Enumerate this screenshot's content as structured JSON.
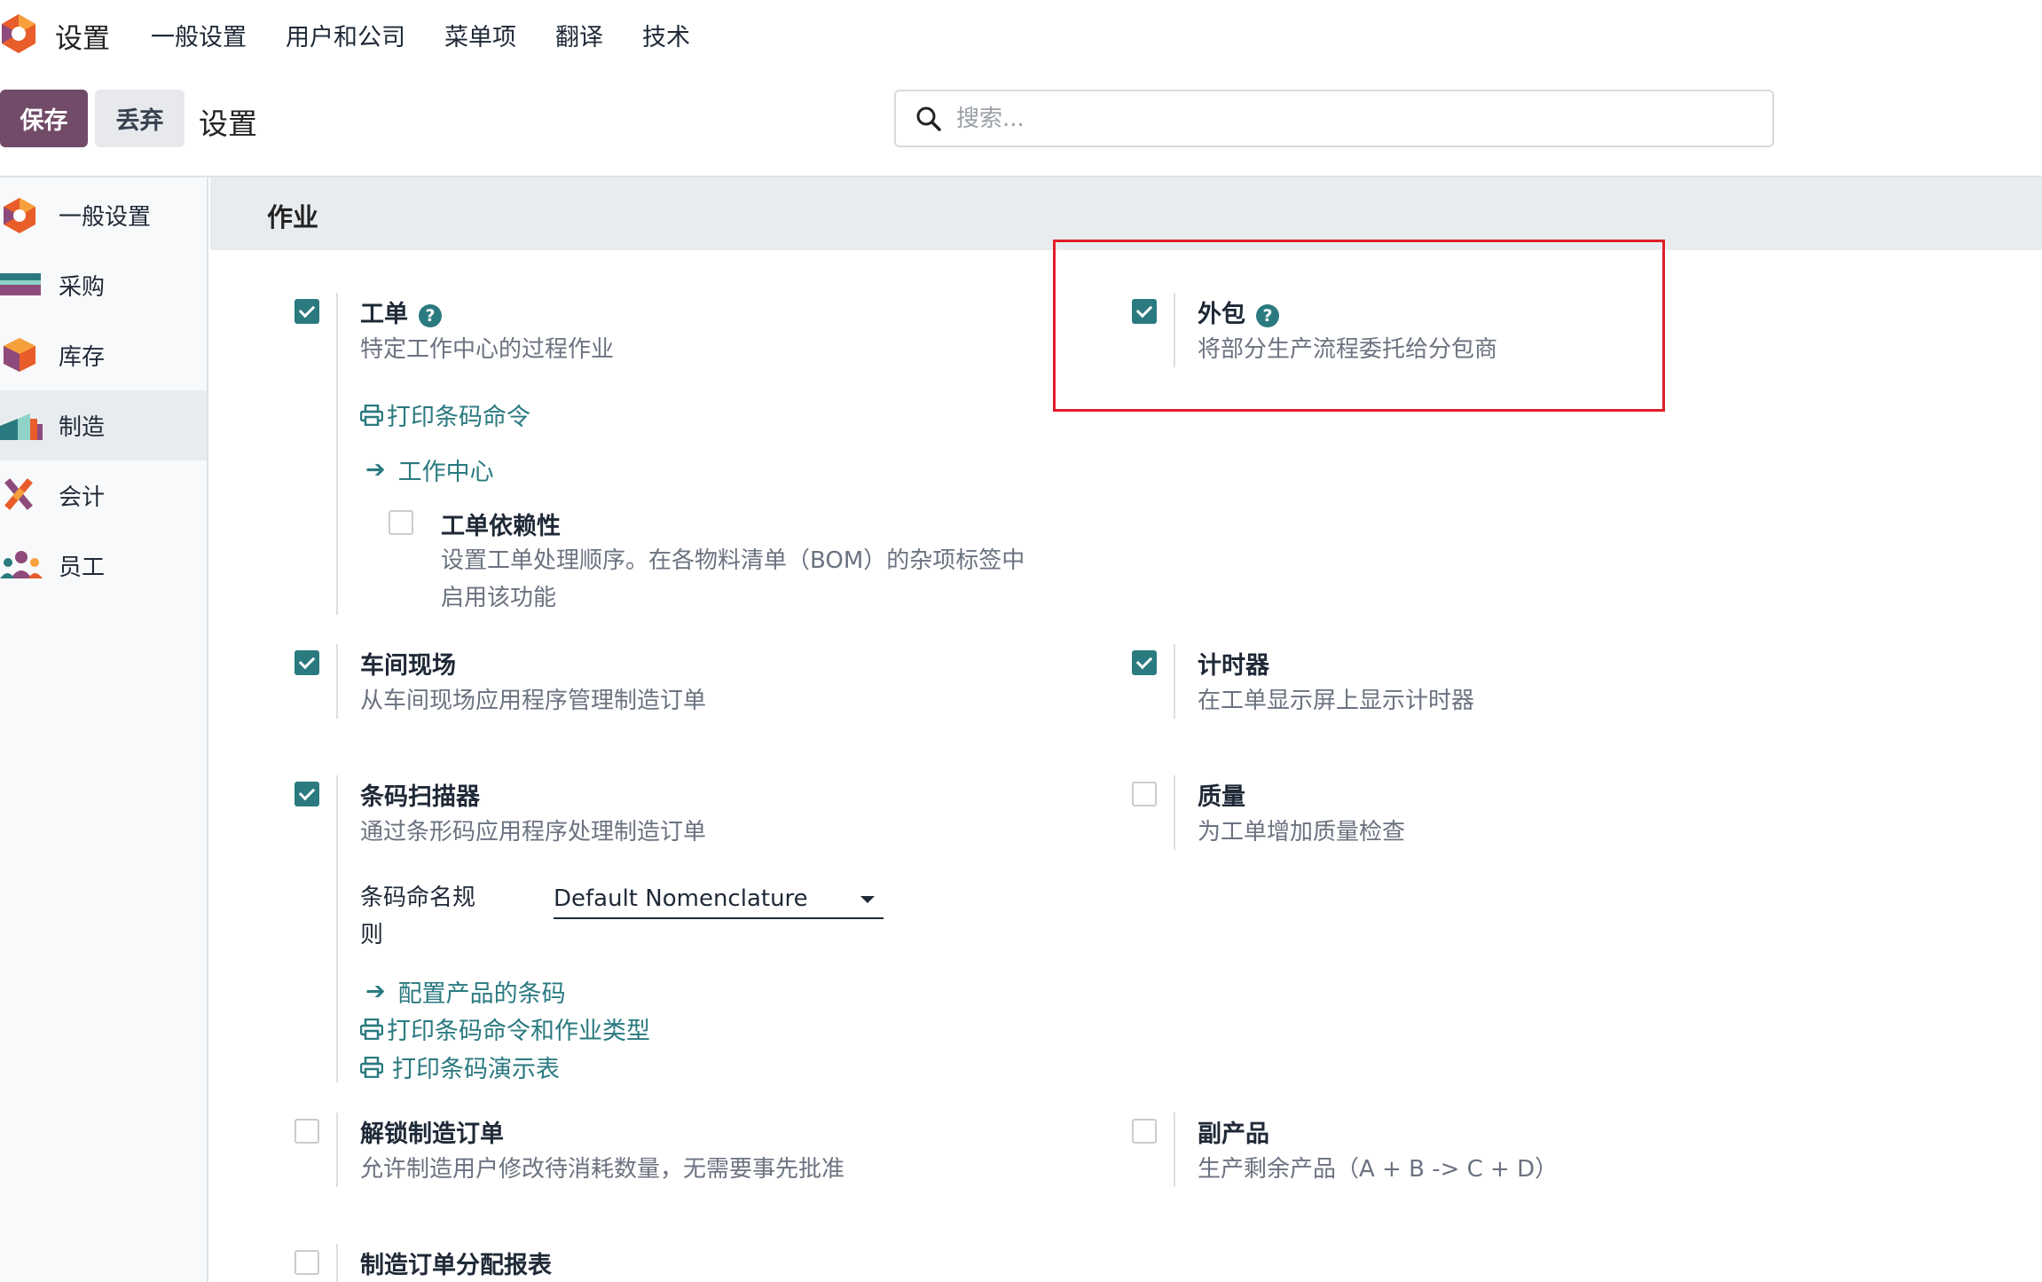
{
  "topnav": {
    "app_title": "设置",
    "menu": [
      "一般设置",
      "用户和公司",
      "菜单项",
      "翻译",
      "技术"
    ]
  },
  "controlbar": {
    "save_label": "保存",
    "discard_label": "丢弃",
    "breadcrumb": "设置",
    "search_placeholder": "搜索..."
  },
  "sidebar": {
    "items": [
      {
        "label": "一般设置",
        "icon": "odoo-logo-icon"
      },
      {
        "label": "采购",
        "icon": "purchase-icon"
      },
      {
        "label": "库存",
        "icon": "inventory-icon"
      },
      {
        "label": "制造",
        "icon": "manufacturing-icon",
        "active": true
      },
      {
        "label": "会计",
        "icon": "accounting-icon"
      },
      {
        "label": "员工",
        "icon": "employees-icon"
      }
    ]
  },
  "section": {
    "title": "作业"
  },
  "settings": {
    "workorders": {
      "title": "工单",
      "checked": true,
      "desc": "特定工作中心的过程作业",
      "link_print": "打印条码命令",
      "link_workcenters": "工作中心",
      "dependencies": {
        "title": "工单依赖性",
        "checked": false,
        "desc_line1": "设置工单处理顺序。在各物料清单（BOM）的杂项标签中",
        "desc_line2": "启用该功能"
      }
    },
    "subcontracting": {
      "title": "外包",
      "checked": true,
      "desc": "将部分生产流程委托给分包商"
    },
    "shopfloor": {
      "title": "车间现场",
      "checked": true,
      "desc": "从车间现场应用程序管理制造订单"
    },
    "timer": {
      "title": "计时器",
      "checked": true,
      "desc": "在工单显示屏上显示计时器"
    },
    "barcode": {
      "title": "条码扫描器",
      "checked": true,
      "desc": "通过条形码应用程序处理制造订单",
      "nomenclature_label_1": "条码命名规",
      "nomenclature_label_2": "则",
      "nomenclature_value": "Default Nomenclature",
      "link_configure": "配置产品的条码",
      "link_print_types": "打印条码命令和作业类型",
      "link_print_demo": "打印条码演示表"
    },
    "quality": {
      "title": "质量",
      "checked": false,
      "desc": "为工单增加质量检查"
    },
    "unlock": {
      "title": "解锁制造订单",
      "checked": false,
      "desc": "允许制造用户修改待消耗数量，无需要事先批准"
    },
    "byproducts": {
      "title": "副产品",
      "checked": false,
      "desc": "生产剩余产品（A + B -> C + D）"
    },
    "allocation": {
      "title": "制造订单分配报表",
      "checked": false
    }
  },
  "colors": {
    "brand": "#714b67",
    "accent": "#2a7a80",
    "highlight": "#e11d2a"
  }
}
